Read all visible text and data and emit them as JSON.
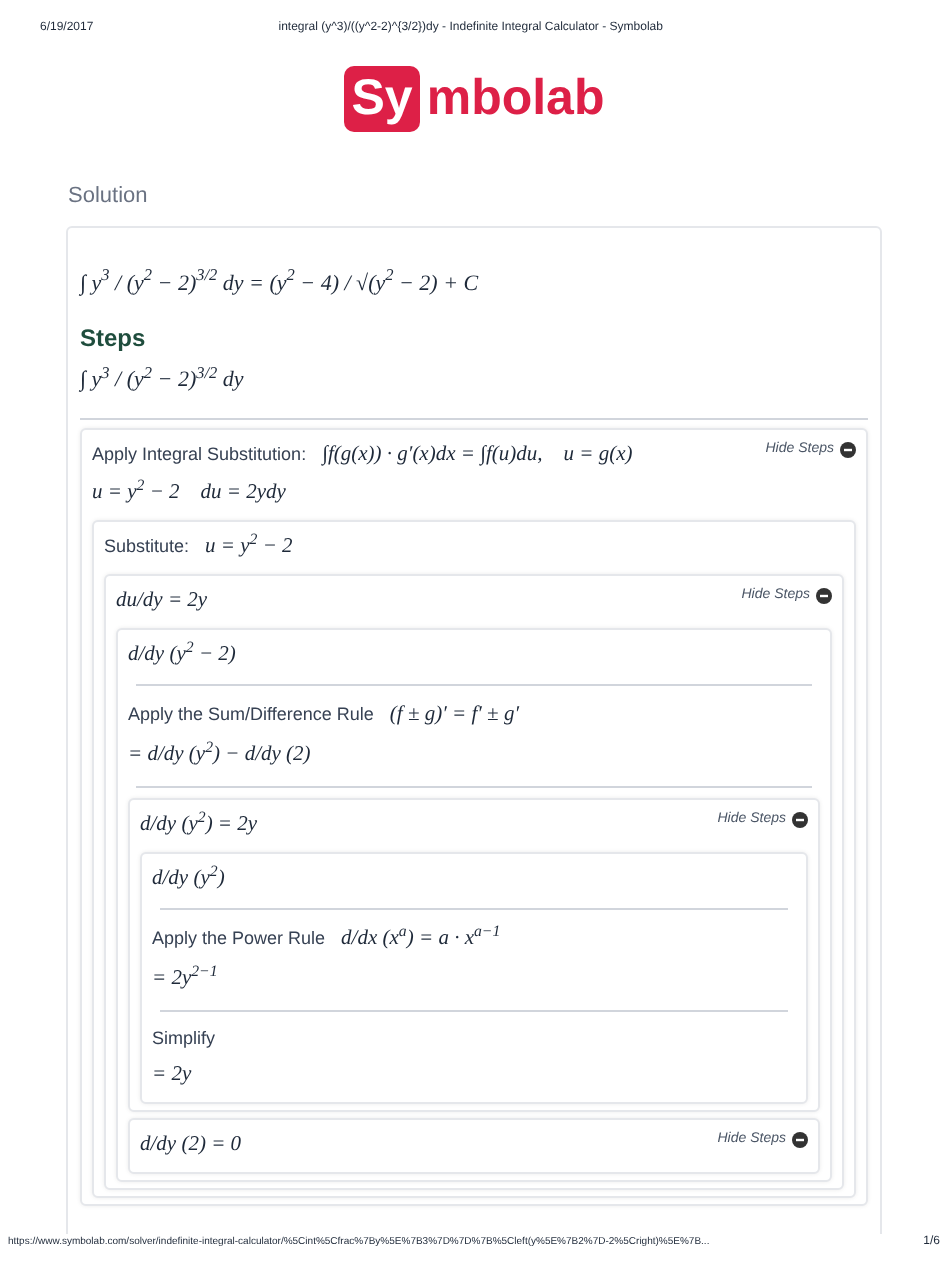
{
  "print_header": {
    "date": "6/19/2017",
    "title": "integral (y^3)/((y^2-2)^{3/2})dy - Indefinite Integral Calculator - Symbolab"
  },
  "logo": {
    "badge": "Sy",
    "rest": "mbolab"
  },
  "solution_label": "Solution",
  "result": "∫ y$^{3}$ / (y$^{2}$ − 2)$^{3/2}$ dy = (y$^{2}$ − 4) / √(y$^{2}$ − 2) + C",
  "steps_heading": "Steps",
  "problem": "∫ y$^{3}$ / (y$^{2}$ − 2)$^{3/2}$ dy",
  "steps": [
    {
      "kind": "panel",
      "toggle": "Hide Steps",
      "header": [
        {
          "kind": "line",
          "label": "Apply Integral Substitution:",
          "math": "∫f(g(x)) · g′(x)dx = ∫f(u)du,    u = g(x)"
        },
        {
          "kind": "line",
          "math": "u = y$^{2}$ − 2    du = 2ydy"
        }
      ],
      "items": [
        {
          "kind": "panel",
          "header": [
            {
              "kind": "line",
              "label": "Substitute:",
              "math": "u = y$^{2}$ − 2"
            }
          ],
          "items": [
            {
              "kind": "panel",
              "toggle": "Hide Steps",
              "header": [
                {
                  "kind": "line",
                  "math": "du/dy = 2y"
                }
              ],
              "items": [
                {
                  "kind": "panel",
                  "header": [
                    {
                      "kind": "line",
                      "math": "d/dy (y$^{2}$ − 2)"
                    }
                  ],
                  "items": [
                    {
                      "kind": "rule"
                    },
                    {
                      "kind": "line",
                      "label": "Apply the Sum/Difference Rule",
                      "math": "(f ± g)′ = f′ ± g′"
                    },
                    {
                      "kind": "line",
                      "math": "= d/dy (y$^{2}$) − d/dy (2)"
                    },
                    {
                      "kind": "rule"
                    },
                    {
                      "kind": "panel",
                      "toggle": "Hide Steps",
                      "header": [
                        {
                          "kind": "line",
                          "math": "d/dy (y$^{2}$) = 2y"
                        }
                      ],
                      "items": [
                        {
                          "kind": "panel",
                          "header": [
                            {
                              "kind": "line",
                              "math": "d/dy (y$^{2}$)"
                            }
                          ],
                          "items": [
                            {
                              "kind": "rule"
                            },
                            {
                              "kind": "line",
                              "label": "Apply the Power Rule",
                              "math": "d/dx (x$^{a}$) = a · x$^{a−1}$"
                            },
                            {
                              "kind": "line",
                              "math": "= 2y$^{2−1}$"
                            },
                            {
                              "kind": "rule"
                            },
                            {
                              "kind": "line",
                              "label": "Simplify"
                            },
                            {
                              "kind": "line",
                              "math": "= 2y"
                            }
                          ]
                        }
                      ]
                    },
                    {
                      "kind": "panel",
                      "toggle": "Hide Steps",
                      "header": [
                        {
                          "kind": "line",
                          "math": "d/dy (2) = 0"
                        }
                      ]
                    }
                  ]
                }
              ]
            }
          ]
        }
      ]
    }
  ],
  "print_footer": {
    "url": "https://www.symbolab.com/solver/indefinite-integral-calculator/%5Cint%5Cfrac%7By%5E%7B3%7D%7D%7B%5Cleft(y%5E%7B2%7D-2%5Cright)%5E%7B...",
    "page": "1/6"
  }
}
